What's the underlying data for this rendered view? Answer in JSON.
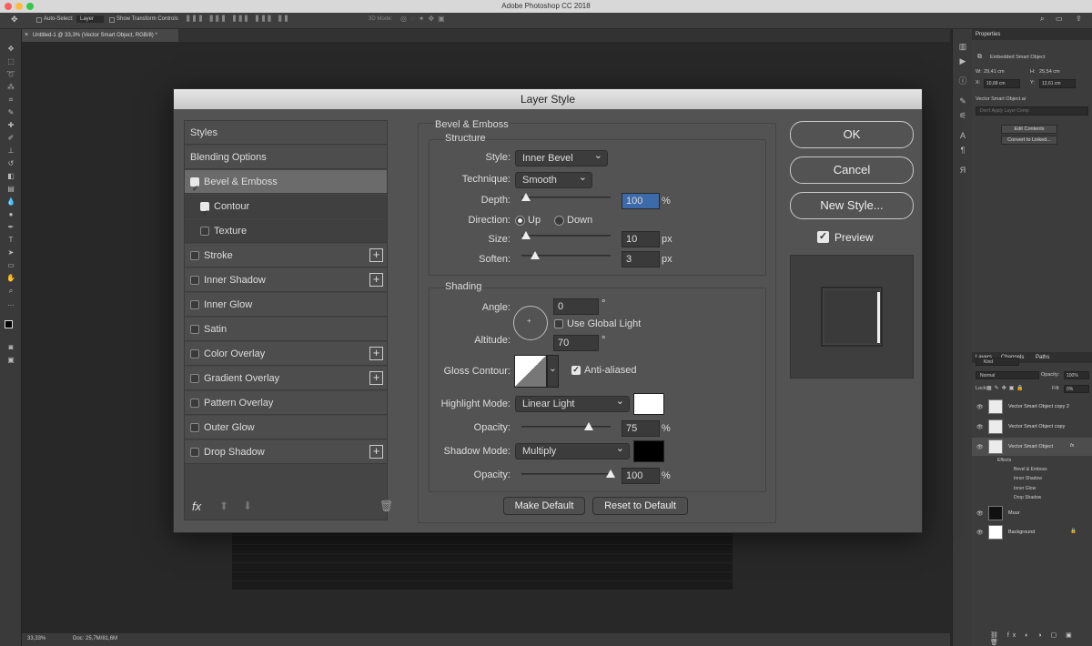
{
  "app": {
    "window_title": "Adobe Photoshop CC 2018"
  },
  "options_bar": {
    "auto_select_label": "Auto-Select:",
    "auto_select_value": "Layer",
    "show_transform": "Show Transform Controls",
    "mode_3d": "3D Mode:"
  },
  "document_tab": {
    "title": "Untitled-1 @ 33,3% (Vector Smart Object, RGB/8) *"
  },
  "status_bar": {
    "zoom": "33,33%",
    "doc_info": "Doc: 25,7M/81,6M"
  },
  "properties_panel": {
    "tab": "Properties",
    "type": "Embedded Smart Object",
    "w_label": "W:",
    "w_value": "29,41 cm",
    "h_label": "H:",
    "h_value": "25,54 cm",
    "x_label": "X:",
    "x_value": "10,68 cm",
    "y_label": "Y:",
    "y_value": "12,61 cm",
    "filename": "Vector Smart Object.ai",
    "layer_comp": "Don't Apply Layer Comp",
    "edit_contents": "Edit Contents",
    "convert_linked": "Convert to Linked..."
  },
  "layers_panel": {
    "tabs": [
      "Layers",
      "Channels",
      "Paths"
    ],
    "kind": "Kind",
    "blend": "Normal",
    "opacity_label": "Opacity:",
    "opacity": "100%",
    "lock_label": "Lock:",
    "fill_label": "Fill:",
    "fill": "0%",
    "layers": [
      "Vector Smart Object copy 2",
      "Vector Smart Object copy",
      "Vector Smart Object"
    ],
    "effects_label": "Effects",
    "effects": [
      "Bevel & Emboss",
      "Inner Shadow",
      "Inner Glow",
      "Drop Shadow"
    ],
    "muur": "Muur",
    "background": "Background"
  },
  "dialog": {
    "title": "Layer Style",
    "styles_list": [
      {
        "label": "Styles",
        "checkbox": null,
        "plus": false
      },
      {
        "label": "Blending Options",
        "checkbox": null,
        "plus": false
      },
      {
        "label": "Bevel & Emboss",
        "checkbox": true,
        "plus": false
      },
      {
        "label": "Contour",
        "checkbox": true,
        "plus": false
      },
      {
        "label": "Texture",
        "checkbox": false,
        "plus": false
      },
      {
        "label": "Stroke",
        "checkbox": false,
        "plus": true
      },
      {
        "label": "Inner Shadow",
        "checkbox": false,
        "plus": true
      },
      {
        "label": "Inner Glow",
        "checkbox": false,
        "plus": false
      },
      {
        "label": "Satin",
        "checkbox": false,
        "plus": false
      },
      {
        "label": "Color Overlay",
        "checkbox": false,
        "plus": true
      },
      {
        "label": "Gradient Overlay",
        "checkbox": false,
        "plus": true
      },
      {
        "label": "Pattern Overlay",
        "checkbox": false,
        "plus": false
      },
      {
        "label": "Outer Glow",
        "checkbox": false,
        "plus": false
      },
      {
        "label": "Drop Shadow",
        "checkbox": false,
        "plus": true
      }
    ],
    "fx_label": "fx",
    "section_title": "Bevel & Emboss",
    "structure": {
      "title": "Structure",
      "style_label": "Style:",
      "style": "Inner Bevel",
      "technique_label": "Technique:",
      "technique": "Smooth",
      "depth_label": "Depth:",
      "depth": "100",
      "depth_unit": "%",
      "depth_slider": 0.05,
      "direction_label": "Direction:",
      "direction_up": "Up",
      "direction_down": "Down",
      "size_label": "Size:",
      "size": "10",
      "size_unit": "px",
      "size_slider": 0.05,
      "soften_label": "Soften:",
      "soften": "3",
      "soften_unit": "px",
      "soften_slider": 0.15
    },
    "shading": {
      "title": "Shading",
      "angle_label": "Angle:",
      "angle": "0",
      "angle_unit": "°",
      "use_global_light": "Use Global Light",
      "altitude_label": "Altitude:",
      "altitude": "70",
      "altitude_unit": "°",
      "gloss_label": "Gloss Contour:",
      "anti_aliased": "Anti-aliased",
      "highlight_label": "Highlight Mode:",
      "highlight_mode": "Linear Light",
      "highlight_color": "#ffffff",
      "highlight_opacity_label": "Opacity:",
      "highlight_opacity": "75",
      "highlight_opacity_unit": "%",
      "highlight_slider": 0.75,
      "shadow_label": "Shadow Mode:",
      "shadow_mode": "Multiply",
      "shadow_color": "#000000",
      "shadow_opacity_label": "Opacity:",
      "shadow_opacity": "100",
      "shadow_opacity_unit": "%",
      "shadow_slider": 1.0
    },
    "make_default": "Make Default",
    "reset_default": "Reset to Default",
    "ok": "OK",
    "cancel": "Cancel",
    "new_style": "New Style...",
    "preview_label": "Preview"
  }
}
